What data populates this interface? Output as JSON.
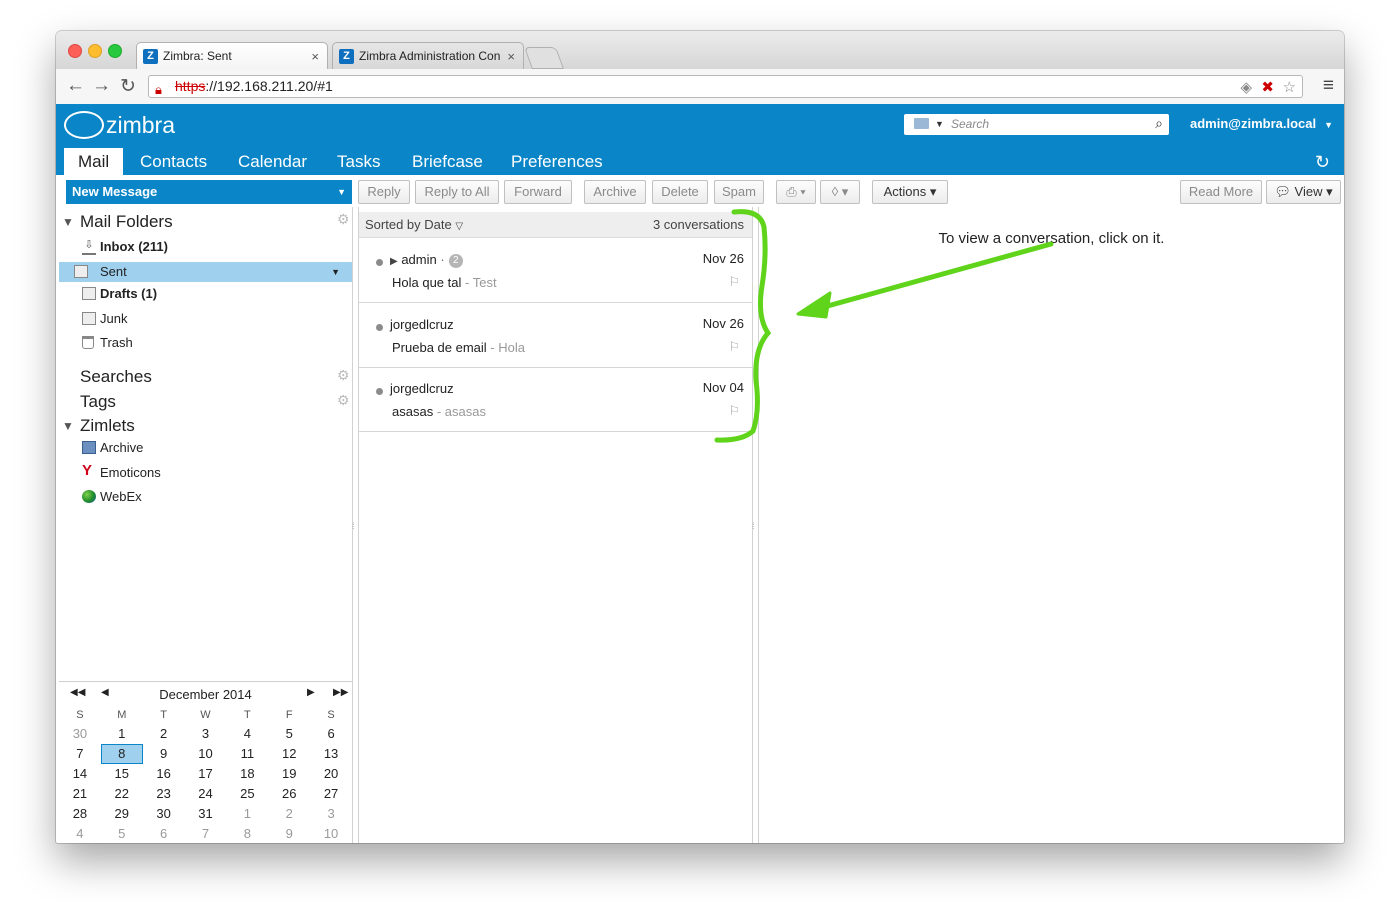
{
  "browser": {
    "tabs": [
      {
        "title": "Zimbra: Sent",
        "close": "×"
      },
      {
        "title": "Zimbra Administration Con",
        "close": "×"
      }
    ],
    "url_protocol": "https",
    "url_rest": "://192.168.211.20/#1"
  },
  "header": {
    "logo": "zimbra",
    "search_placeholder": "Search",
    "user": "admin@zimbra.local",
    "app_tabs": [
      "Mail",
      "Contacts",
      "Calendar",
      "Tasks",
      "Briefcase",
      "Preferences"
    ]
  },
  "toolbar": {
    "new_message": "New Message",
    "reply": "Reply",
    "reply_all": "Reply to All",
    "forward": "Forward",
    "archive": "Archive",
    "delete": "Delete",
    "spam": "Spam",
    "actions": "Actions",
    "read_more": "Read More",
    "view": "View"
  },
  "sidebar": {
    "mail_folders": "Mail Folders",
    "folders": [
      {
        "label": "Inbox (211)"
      },
      {
        "label": "Sent"
      },
      {
        "label": "Drafts (1)"
      },
      {
        "label": "Junk"
      },
      {
        "label": "Trash"
      }
    ],
    "searches": "Searches",
    "tags": "Tags",
    "zimlets": "Zimlets",
    "zimlet_items": [
      {
        "label": "Archive"
      },
      {
        "label": "Emoticons"
      },
      {
        "label": "WebEx"
      }
    ]
  },
  "calendar": {
    "month": "December 2014",
    "days_of_week": [
      "S",
      "M",
      "T",
      "W",
      "T",
      "F",
      "S"
    ],
    "weeks": [
      [
        "30",
        "1",
        "2",
        "3",
        "4",
        "5",
        "6"
      ],
      [
        "7",
        "8",
        "9",
        "10",
        "11",
        "12",
        "13"
      ],
      [
        "14",
        "15",
        "16",
        "17",
        "18",
        "19",
        "20"
      ],
      [
        "21",
        "22",
        "23",
        "24",
        "25",
        "26",
        "27"
      ],
      [
        "28",
        "29",
        "30",
        "31",
        "1",
        "2",
        "3"
      ],
      [
        "4",
        "5",
        "6",
        "7",
        "8",
        "9",
        "10"
      ]
    ],
    "today": "8"
  },
  "list": {
    "sort_label": "Sorted by Date",
    "count_label": "3 conversations",
    "conversations": [
      {
        "from": "admin",
        "count": "2",
        "date": "Nov 26",
        "subject": "Hola que tal",
        "fragment": "Test"
      },
      {
        "from": "jorgedlcruz",
        "count": "",
        "date": "Nov 26",
        "subject": "Prueba de email",
        "fragment": "Hola"
      },
      {
        "from": "jorgedlcruz",
        "count": "",
        "date": "Nov 04",
        "subject": "asasas",
        "fragment": "asasas"
      }
    ]
  },
  "reading_pane": {
    "hint": "To view a conversation, click on it."
  },
  "colors": {
    "brand": "#0a85c7",
    "selection": "#9fd0ee",
    "annotation": "#5fd41a"
  }
}
